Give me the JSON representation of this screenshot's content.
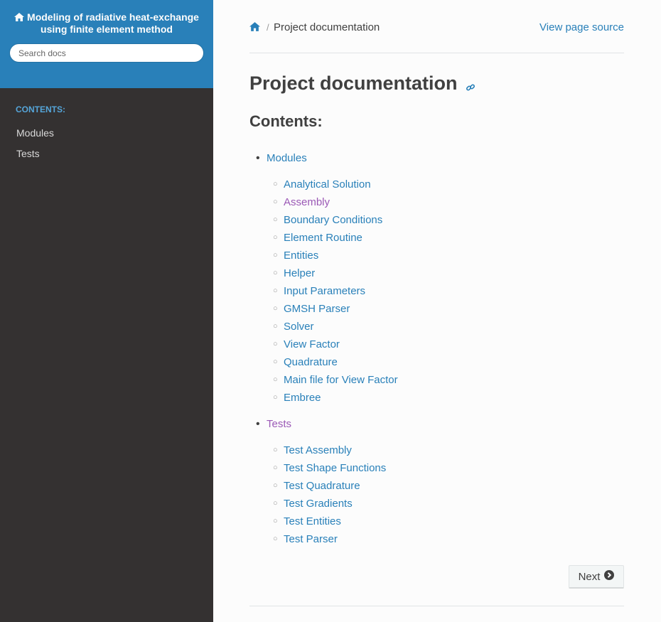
{
  "sidebar": {
    "project_title": "Modeling of radiative heat-exchange using finite element method",
    "search_placeholder": "Search docs",
    "caption": "CONTENTS:",
    "nav_items": [
      {
        "label": "Modules"
      },
      {
        "label": "Tests"
      }
    ]
  },
  "breadcrumbs": {
    "home_icon": "home-icon",
    "current": "Project documentation",
    "view_source": "View page source"
  },
  "main": {
    "title": "Project documentation",
    "headerlink_icon": "link-icon",
    "contents_heading": "Contents:",
    "toc": [
      {
        "label": "Modules",
        "visited": false,
        "children": [
          {
            "label": "Analytical Solution",
            "visited": false
          },
          {
            "label": "Assembly",
            "visited": true
          },
          {
            "label": "Boundary Conditions",
            "visited": false
          },
          {
            "label": "Element Routine",
            "visited": false
          },
          {
            "label": "Entities",
            "visited": false
          },
          {
            "label": "Helper",
            "visited": false
          },
          {
            "label": "Input Parameters",
            "visited": false
          },
          {
            "label": "GMSH Parser",
            "visited": false
          },
          {
            "label": "Solver",
            "visited": false
          },
          {
            "label": "View Factor",
            "visited": false
          },
          {
            "label": "Quadrature",
            "visited": false
          },
          {
            "label": "Main file for View Factor",
            "visited": false
          },
          {
            "label": "Embree",
            "visited": false
          }
        ]
      },
      {
        "label": "Tests",
        "visited": true,
        "children": [
          {
            "label": "Test Assembly",
            "visited": false
          },
          {
            "label": "Test Shape Functions",
            "visited": false
          },
          {
            "label": "Test Quadrature",
            "visited": false
          },
          {
            "label": "Test Gradients",
            "visited": false
          },
          {
            "label": "Test Entities",
            "visited": false
          },
          {
            "label": "Test Parser",
            "visited": false
          }
        ]
      }
    ],
    "next_label": "Next",
    "next_icon": "arrow-circle-right-icon"
  },
  "colors": {
    "link": "#2980b9",
    "visited": "#9b59b6",
    "sidebar_bg": "#343131",
    "sidebar_top": "#2980b9"
  }
}
